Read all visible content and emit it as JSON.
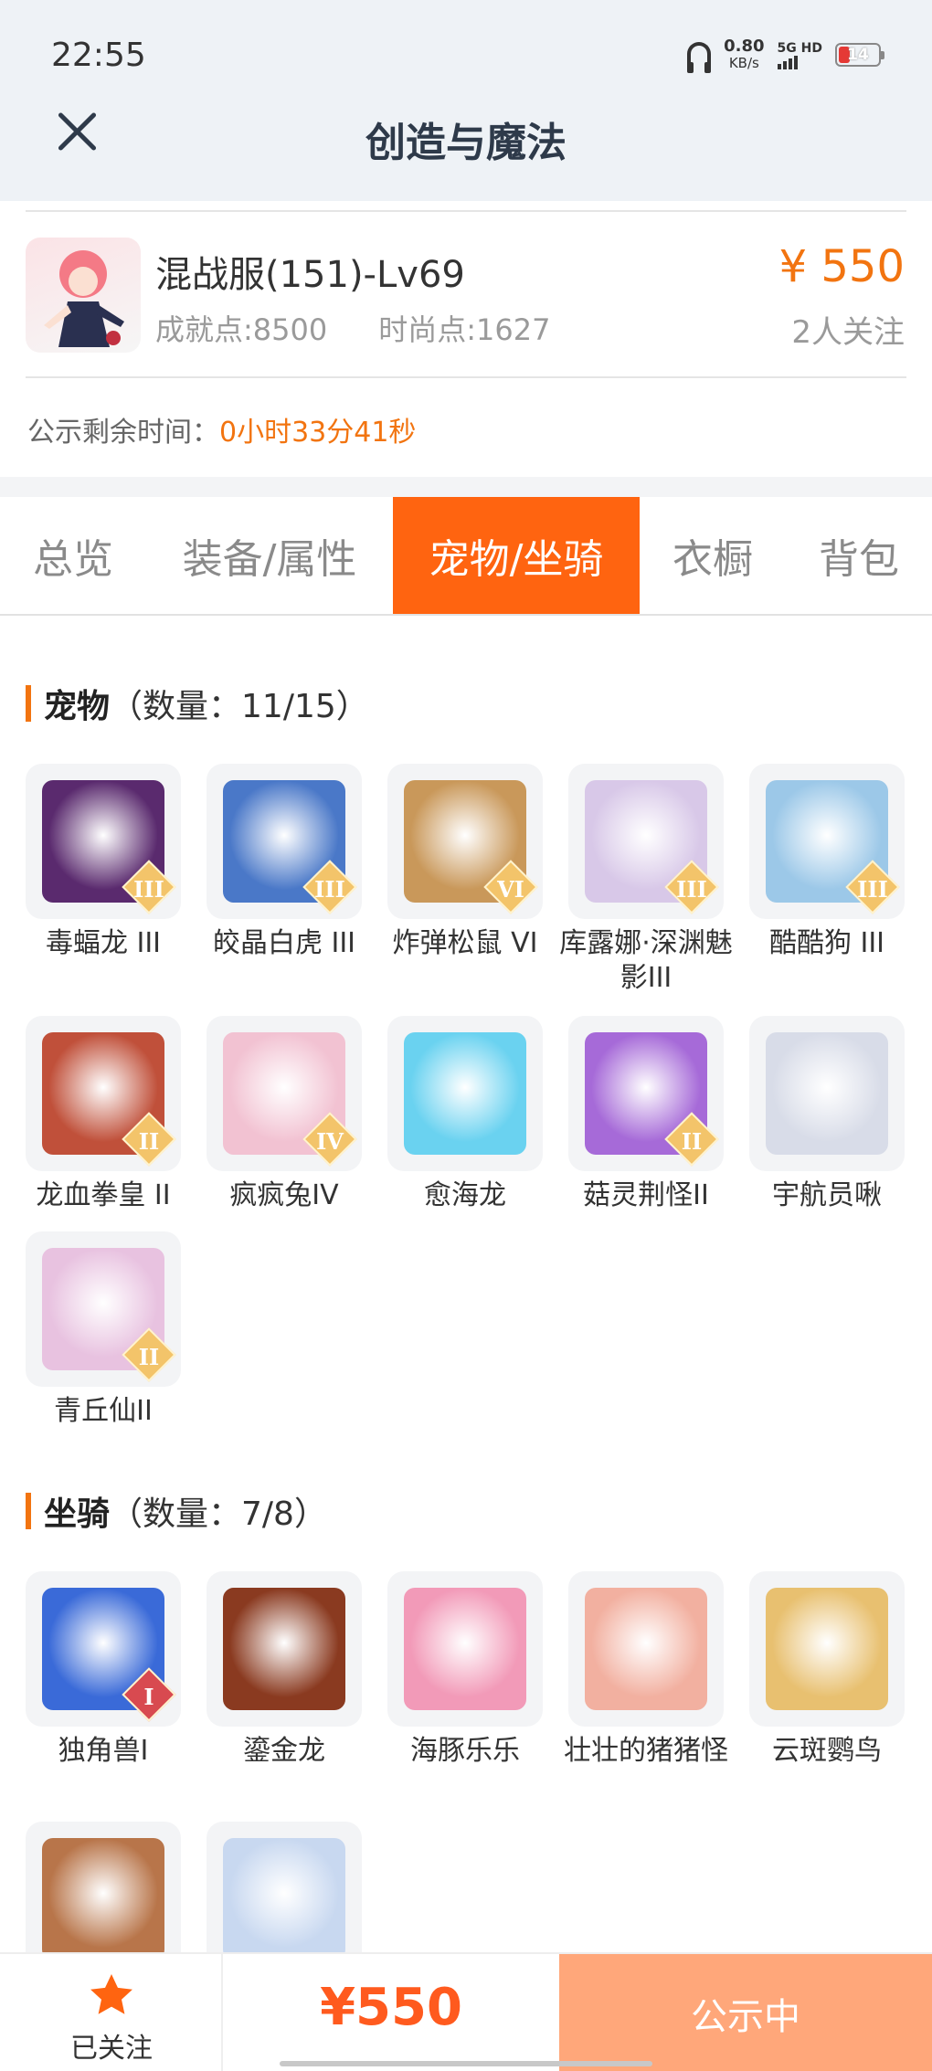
{
  "status_bar": {
    "time": "22:55",
    "net_speed": "0.80",
    "net_unit": "KB/s",
    "signal_label": "5G HD",
    "battery": "14"
  },
  "header": {
    "title": "创造与魔法"
  },
  "character": {
    "name": "混战服(151)-Lv69",
    "achievement": "成就点:8500",
    "fashion": "时尚点:1627",
    "price": "¥ 550",
    "followers": "2人关注"
  },
  "notice": {
    "label": "公示剩余时间：",
    "value": "0小时33分41秒"
  },
  "tabs": [
    {
      "label": "总览"
    },
    {
      "label": "装备/属性"
    },
    {
      "label": "宠物/坐骑"
    },
    {
      "label": "衣橱"
    },
    {
      "label": "背包"
    }
  ],
  "pets": {
    "title": "宠物",
    "count": "（数量：11/15）",
    "items": [
      {
        "label": "毒蝠龙 III",
        "badge": "III",
        "color": "#5a2a6e"
      },
      {
        "label": "皎晶白虎 III",
        "badge": "III",
        "color": "#4a78c8"
      },
      {
        "label": "炸弹松鼠 VI",
        "badge": "VI",
        "color": "#c9985a"
      },
      {
        "label": "库露娜·深渊魅影III",
        "badge": "III",
        "color": "#d8c8e8"
      },
      {
        "label": "酷酷狗 III",
        "badge": "III",
        "color": "#9cc8e8"
      },
      {
        "label": "龙血拳皇 II",
        "badge": "II",
        "color": "#c0503a"
      },
      {
        "label": "疯疯兔IV",
        "badge": "IV",
        "color": "#f2c2d2"
      },
      {
        "label": "愈海龙",
        "badge": "",
        "color": "#6ad2f0"
      },
      {
        "label": "菇灵荆怪II",
        "badge": "II",
        "color": "#a66ad8"
      },
      {
        "label": "宇航员啾",
        "badge": "",
        "color": "#d8dce8"
      },
      {
        "label": "青丘仙II",
        "badge": "II",
        "color": "#e8c2e0"
      }
    ]
  },
  "mounts": {
    "title": "坐骑",
    "count": "（数量：7/8）",
    "items": [
      {
        "label": "独角兽I",
        "badge": "I",
        "color": "#3a6ad8"
      },
      {
        "label": "鎏金龙",
        "badge": "",
        "color": "#8a3a20"
      },
      {
        "label": "海豚乐乐",
        "badge": "",
        "color": "#f29ab8"
      },
      {
        "label": "壮壮的猪猪怪",
        "badge": "",
        "color": "#f2b0a0"
      },
      {
        "label": "云斑鹦鸟",
        "badge": "",
        "color": "#e8c070"
      },
      {
        "label": "",
        "badge": "",
        "color": "#b8754a"
      },
      {
        "label": "",
        "badge": "",
        "color": "#c8d8f0"
      }
    ]
  },
  "bottom": {
    "follow_label": "已关注",
    "price": "¥550",
    "status_label": "公示中"
  }
}
